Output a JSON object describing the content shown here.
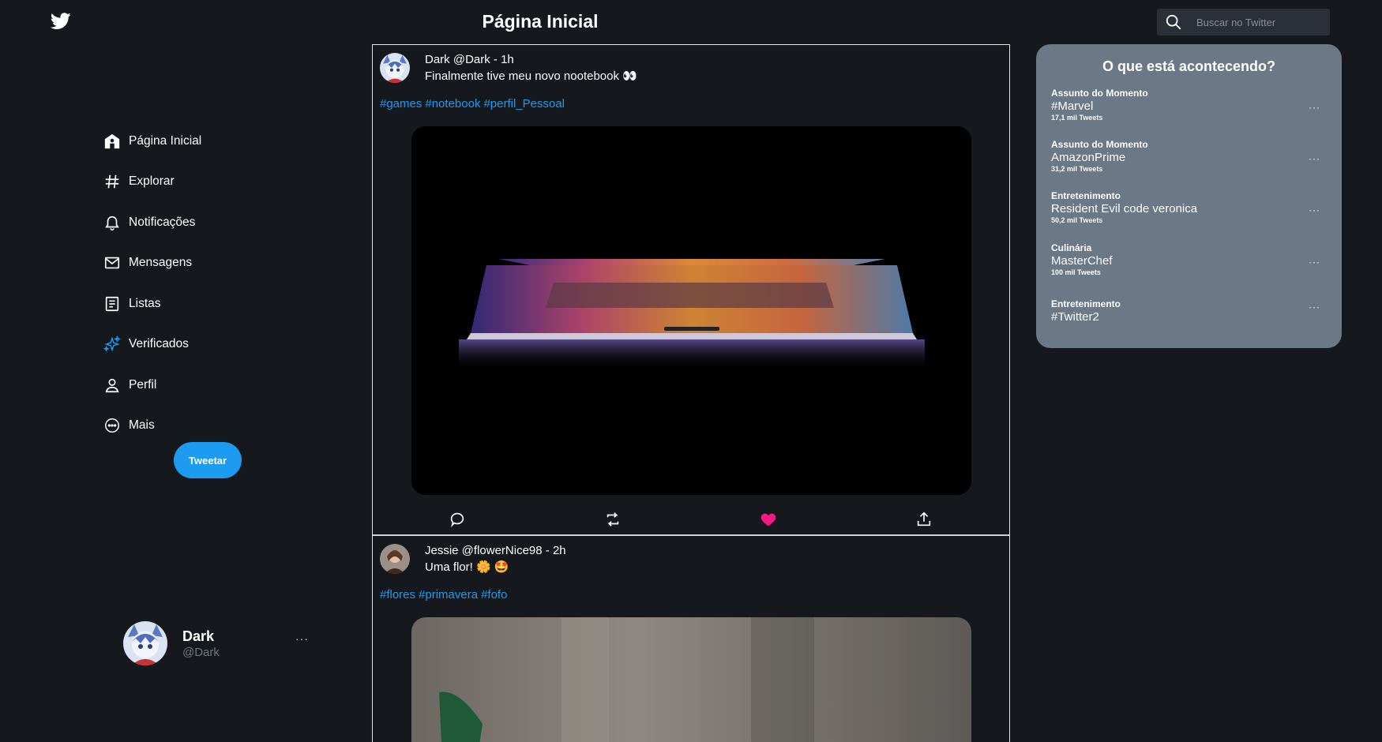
{
  "header": {
    "title": "Página Inicial",
    "search_placeholder": "Buscar no Twitter",
    "logo_icon": "twitter-bird-icon"
  },
  "sidebar": {
    "items": [
      {
        "label": "Página Inicial",
        "icon": "home-icon"
      },
      {
        "label": "Explorar",
        "icon": "hashtag-icon"
      },
      {
        "label": "Notificações",
        "icon": "bell-icon"
      },
      {
        "label": "Mensagens",
        "icon": "envelope-icon"
      },
      {
        "label": "Listas",
        "icon": "list-icon"
      },
      {
        "label": "Verificados",
        "icon": "sparkle-icon"
      },
      {
        "label": "Perfil",
        "icon": "person-icon"
      },
      {
        "label": "Mais",
        "icon": "more-circle-icon"
      }
    ],
    "tweet_button": "Tweetar",
    "profile": {
      "name": "Dark",
      "handle": "@Dark",
      "more": "···"
    }
  },
  "feed": {
    "tweets": [
      {
        "header": "Dark @Dark - 1h",
        "text": "Finalmente tive meu novo nootebook 👀",
        "tags": [
          "#games",
          "#notebook",
          "#perfil_Pessoal"
        ],
        "liked": true
      },
      {
        "header": "Jessie @flowerNice98 - 2h",
        "text": "Uma flor! 🌼 🤩",
        "tags": [
          "#flores",
          "#primavera",
          "#fofo"
        ]
      }
    ]
  },
  "trends": {
    "title": "O que está acontecendo?",
    "items": [
      {
        "category": "Assunto do Momento",
        "name": "#Marvel",
        "count": "17,1 mil Tweets"
      },
      {
        "category": "Assunto do Momento",
        "name": "AmazonPrime",
        "count": "31,2 mil Tweets"
      },
      {
        "category": "Entretenimento",
        "name": "Resident Evil code veronica",
        "count": "50,2 mil Tweets"
      },
      {
        "category": "Culinária",
        "name": "MasterChef",
        "count": "100 mil Tweets"
      },
      {
        "category": "Entretenimento",
        "name": "#Twitter2",
        "count": ""
      }
    ],
    "more": "···"
  },
  "colors": {
    "background": "#15181d",
    "accent": "#1d9bf0",
    "trends_panel": "#6b7886",
    "like": "#f91880"
  }
}
